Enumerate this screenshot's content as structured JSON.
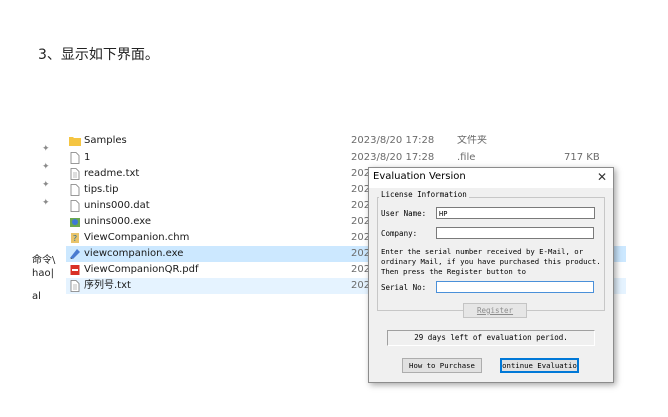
{
  "heading": "3、显示如下界面。",
  "left_labels": [
    "命令\\",
    "hao|",
    "al"
  ],
  "files": [
    {
      "name": "Samples",
      "date": "2023/8/20 17:28",
      "type": "文件夹",
      "size": "",
      "icon": "folder-icon"
    },
    {
      "name": "1",
      "date": "2023/8/20 17:28",
      "type": ".file",
      "size": "717 KB",
      "icon": "file-icon"
    },
    {
      "name": "readme.txt",
      "date": "2023",
      "type": "",
      "size": "",
      "icon": "text-file-icon"
    },
    {
      "name": "tips.tip",
      "date": "2023",
      "type": "",
      "size": "",
      "icon": "file-icon"
    },
    {
      "name": "unins000.dat",
      "date": "2023",
      "type": "",
      "size": "",
      "icon": "file-icon"
    },
    {
      "name": "unins000.exe",
      "date": "2023",
      "type": "",
      "size": "",
      "icon": "installer-icon"
    },
    {
      "name": "ViewCompanion.chm",
      "date": "2023",
      "type": "",
      "size": "",
      "icon": "help-file-icon"
    },
    {
      "name": "viewcompanion.exe",
      "date": "2023",
      "type": "",
      "size": "",
      "icon": "app-icon"
    },
    {
      "name": "ViewCompanionQR.pdf",
      "date": "2023",
      "type": "",
      "size": "",
      "icon": "pdf-icon"
    },
    {
      "name": "序列号.txt",
      "date": "2023",
      "type": "",
      "size": "",
      "icon": "text-file-icon"
    }
  ],
  "dialog": {
    "title": "Evaluation Version",
    "close": "✕",
    "group_label": "License Information",
    "user_name_label": "User Name:",
    "user_name_value": "HP",
    "company_label": "Company:",
    "company_value": "",
    "info_text": "Enter the serial number received by E-Mail, or ordinary Mail, if you have purchased this product. Then press the Register button to",
    "serial_label": "Serial No:",
    "serial_value": "",
    "register_button": "Register",
    "status_text": "29 days left of evaluation period.",
    "how_to_purchase_button": "How to Purchase",
    "continue_button": "ontinue Evaluatio"
  }
}
